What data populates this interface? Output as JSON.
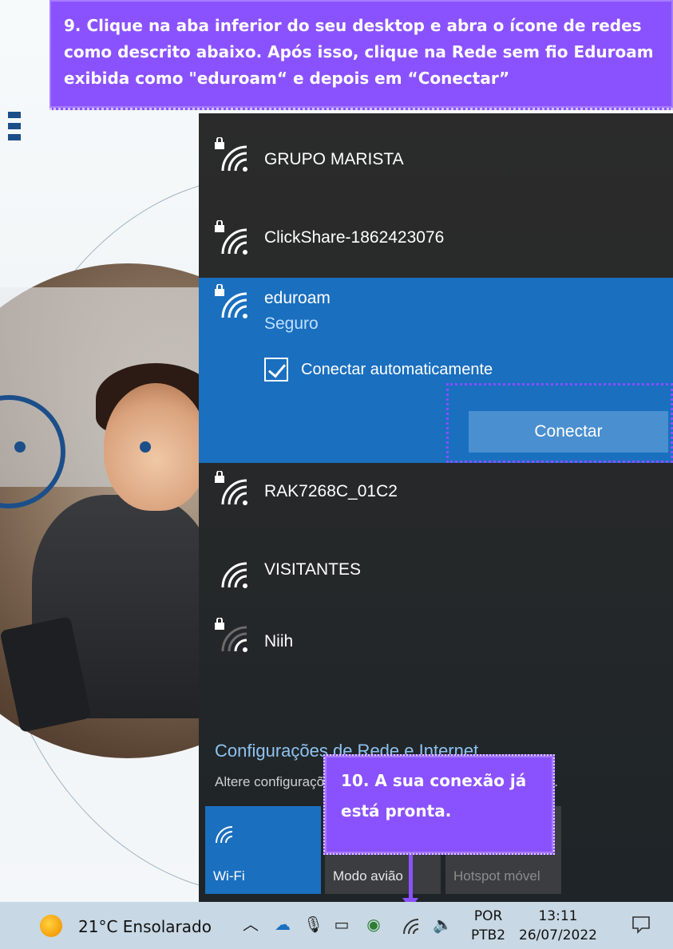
{
  "instructions": {
    "step9": "9. Clique na aba inferior do seu desktop e abra o ícone de redes como descrito abaixo. Após isso, clique na Rede sem fio Eduroam exibida como \"eduroam“ e depois em “Conectar”",
    "step10": "10. A sua conexão já está pronta."
  },
  "networks": [
    {
      "ssid": "GRUPO MARISTA",
      "secured": true
    },
    {
      "ssid": "ClickShare-1862423076",
      "secured": true
    },
    {
      "ssid": "eduroam",
      "secured": true,
      "status": "Seguro",
      "selected": true
    },
    {
      "ssid": "RAK7268C_01C2",
      "secured": true
    },
    {
      "ssid": "VISITANTES",
      "secured": false
    },
    {
      "ssid": "Niih",
      "secured": true
    }
  ],
  "selected_network": {
    "auto_connect_label": "Conectar automaticamente",
    "auto_connect_checked": true,
    "connect_button": "Conectar"
  },
  "settings": {
    "title": "Configurações de Rede e Internet",
    "description": "Altere configurações, como tornar uma conexão limitada."
  },
  "quick_actions": [
    {
      "label": "Wi-Fi",
      "state": "on",
      "icon": "wifi-icon"
    },
    {
      "label": "Modo avião",
      "state": "off",
      "icon": "airplane-icon"
    },
    {
      "label": "Hotspot móvel",
      "state": "disabled",
      "icon": "hotspot-icon"
    }
  ],
  "taskbar": {
    "weather": "21°C  Ensolarado",
    "language_line1": "POR",
    "language_line2": "PTB2",
    "time": "13:11",
    "date": "26/07/2022"
  },
  "colors": {
    "accent": "#1a6fbf",
    "callout": "#8a52ff",
    "flyout_bg": "#2b2b2b",
    "taskbar_bg": "#c8d8e4"
  }
}
